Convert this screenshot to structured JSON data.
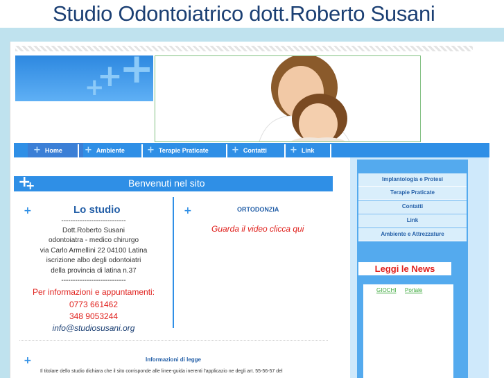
{
  "site_title": "Studio Odontoiatrico dott.Roberto Susani",
  "nav": {
    "items": [
      {
        "label": "Home"
      },
      {
        "label": "Ambiente"
      },
      {
        "label": "Terapie Praticate"
      },
      {
        "label": "Contatti"
      },
      {
        "label": "Link"
      }
    ]
  },
  "welcome": "Benvenuti nel sito",
  "studio": {
    "title": "Lo studio",
    "separator": "----------------------------",
    "lines": [
      "Dott.Roberto Susani",
      "odontoiatra - medico chirurgo",
      "via Carlo Armellini 22 04100 Latina",
      "iscrizione albo degli odontoiatri",
      "della provincia di latina n.37"
    ],
    "separator2": "----------------------------",
    "appointments": "Per informazioni e appuntamenti:",
    "phone1": "0773 661462",
    "phone2": "348 9053244",
    "email": "info@studiosusani.org"
  },
  "ortho": {
    "title": "ORTODONZIA",
    "video": "Guarda il video clicca qui"
  },
  "legal": {
    "title": "Informazioni di legge",
    "text": "Il titolare dello studio dichiara che il sito corrisponde alle linee-guida inerenti l'applicazio ne degli art. 55-56-57 del"
  },
  "sidebar": {
    "items": [
      {
        "label": "Implantologia e Protesi"
      },
      {
        "label": "Terapie Praticate"
      },
      {
        "label": "Contatti"
      },
      {
        "label": "Link"
      },
      {
        "label": "Ambiente e Attrezzature"
      }
    ],
    "news": "Leggi le News",
    "links": [
      {
        "label": "GIOCHI"
      },
      {
        "label": "Portale"
      }
    ]
  },
  "colors": {
    "accent": "#2f8fe6",
    "title": "#1b3f73",
    "highlight": "#e0201c"
  }
}
